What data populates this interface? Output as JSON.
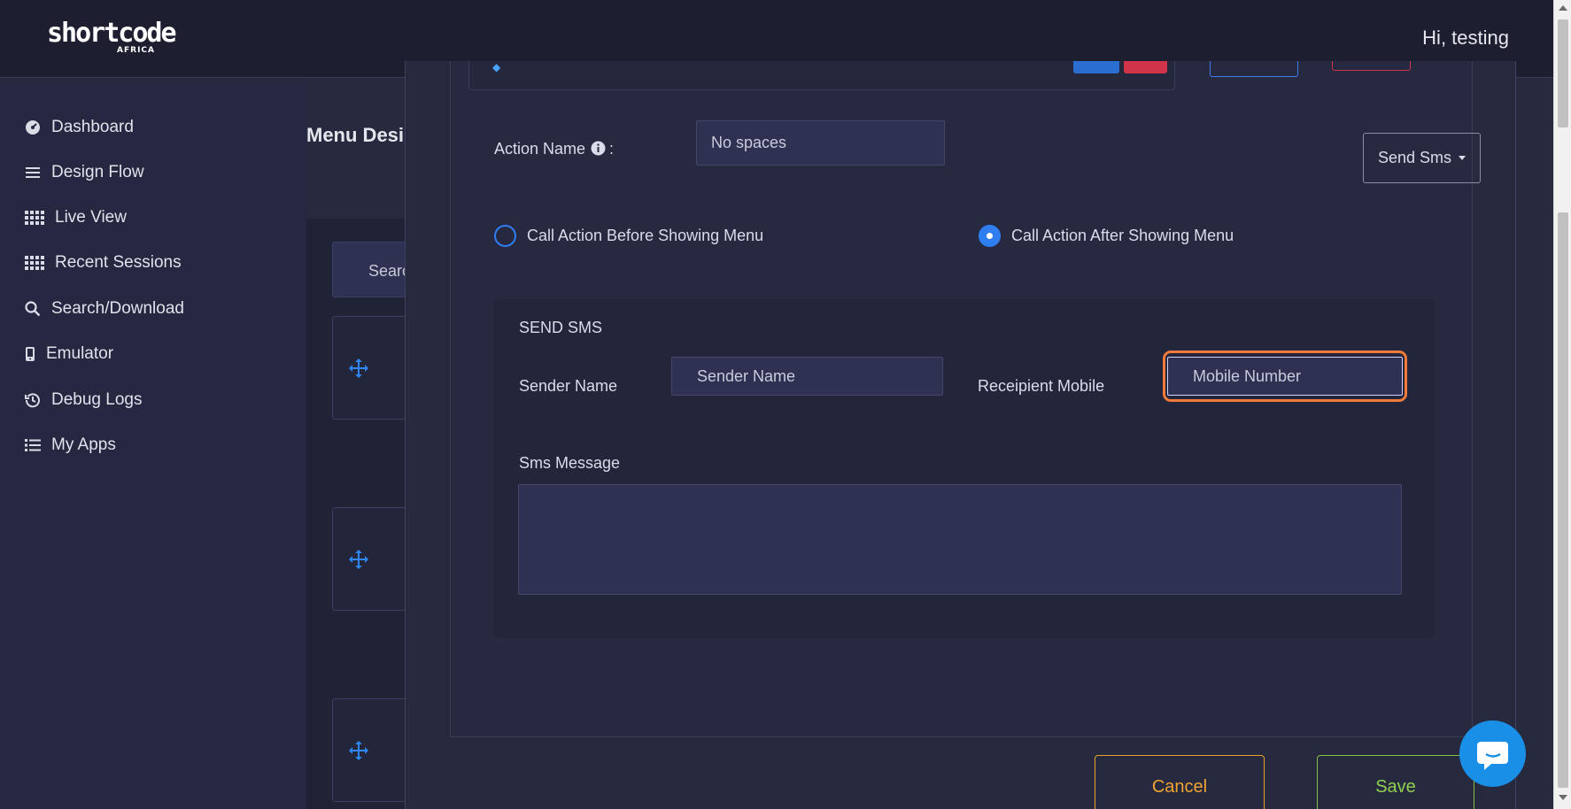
{
  "header": {
    "logo_text": "shortcode",
    "logo_subtext": "AFRICA",
    "greeting": "Hi, testing"
  },
  "sidebar": {
    "items": [
      {
        "label": "Dashboard",
        "icon": "dashboard-icon"
      },
      {
        "label": "Design Flow",
        "icon": "menu-lines-icon"
      },
      {
        "label": "Live View",
        "icon": "grid-icon"
      },
      {
        "label": "Recent Sessions",
        "icon": "grid-icon"
      },
      {
        "label": "Search/Download",
        "icon": "search-icon"
      },
      {
        "label": "Emulator",
        "icon": "mobile-icon"
      },
      {
        "label": "Debug Logs",
        "icon": "history-icon"
      },
      {
        "label": "My Apps",
        "icon": "list-icon"
      }
    ]
  },
  "background": {
    "page_title": "Menu Desi",
    "search_stub": "Searc"
  },
  "modal": {
    "action_name_label": "Action Name",
    "action_name_colon": ":",
    "action_name_placeholder": "No spaces",
    "action_type_button": "Send Sms",
    "radio_before": "Call Action Before Showing Menu",
    "radio_after": "Call Action After Showing Menu",
    "radio_selected": "after",
    "sms_section_title": "SEND SMS",
    "sender_name_label": "Sender Name",
    "sender_name_placeholder": "Sender Name",
    "recipient_label": "Receipient Mobile",
    "recipient_placeholder": "Mobile Number",
    "sms_message_label": "Sms Message",
    "cancel_label": "Cancel",
    "save_label": "Save"
  },
  "colors": {
    "accent_blue": "#2f7ef0",
    "focus_orange": "#f07a3a",
    "cancel_orange": "#f0a431",
    "save_green": "#8fd14f",
    "delete_red": "#d0344b"
  }
}
